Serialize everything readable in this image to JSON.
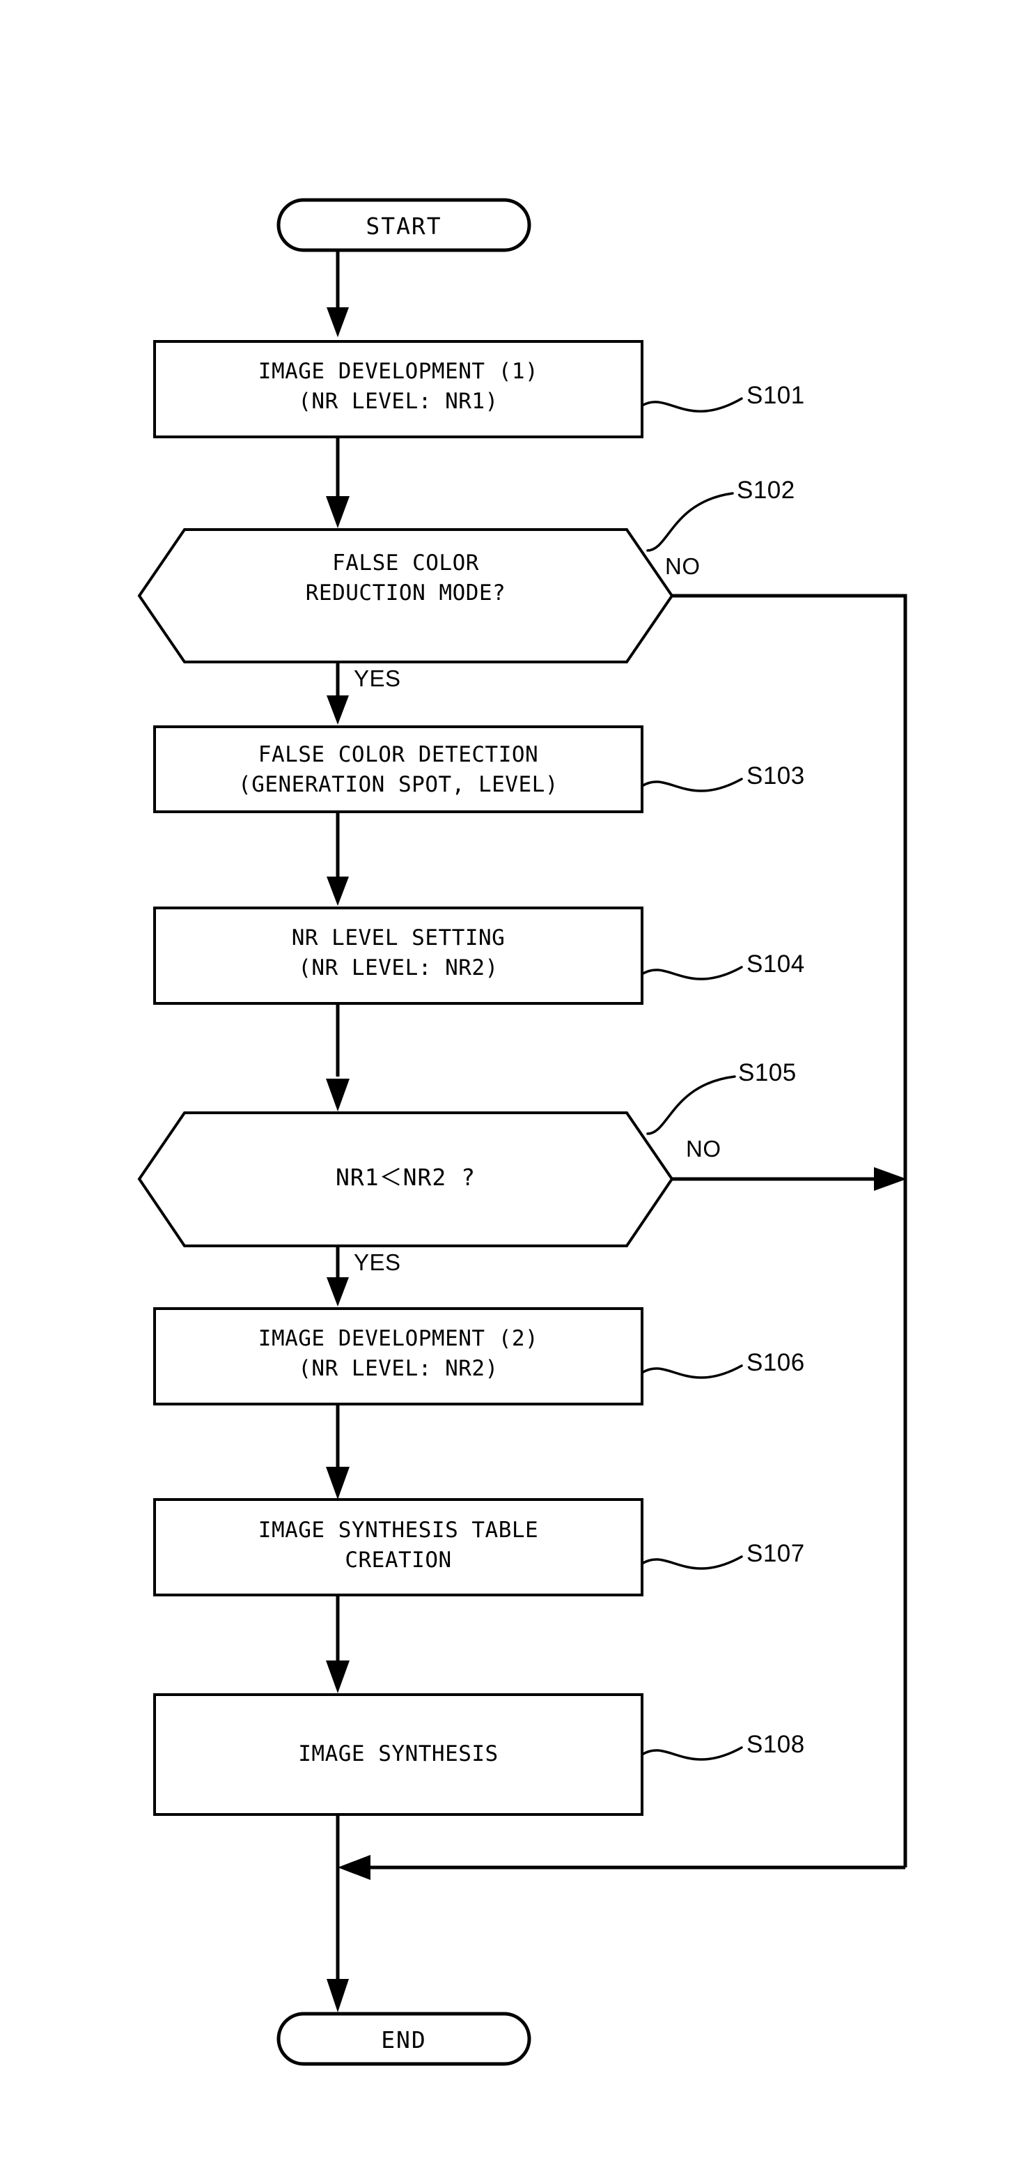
{
  "diagram": {
    "type": "flowchart",
    "title": "",
    "orientation": "top-to-bottom",
    "line_color": "#000000",
    "background_color": "#ffffff"
  },
  "nodes": [
    {
      "id": "start",
      "shape": "terminator",
      "text": "START",
      "step_label": ""
    },
    {
      "id": "s101",
      "shape": "process",
      "line1": "IMAGE DEVELOPMENT (1)",
      "line2": "(NR LEVEL: NR1)",
      "step_label": "S101"
    },
    {
      "id": "s102",
      "shape": "decision",
      "line1": "FALSE COLOR",
      "line2": "REDUCTION MODE?",
      "step_label": "S102",
      "yes_label": "YES",
      "no_label": "NO"
    },
    {
      "id": "s103",
      "shape": "process",
      "line1": "FALSE COLOR DETECTION",
      "line2": "(GENERATION SPOT, LEVEL)",
      "step_label": "S103"
    },
    {
      "id": "s104",
      "shape": "process",
      "line1": "NR LEVEL SETTING",
      "line2": "(NR LEVEL: NR2)",
      "step_label": "S104"
    },
    {
      "id": "s105",
      "shape": "decision",
      "line1": "NR1＜NR2 ?",
      "line2": "",
      "step_label": "S105",
      "yes_label": "YES",
      "no_label": "NO"
    },
    {
      "id": "s106",
      "shape": "process",
      "line1": "IMAGE DEVELOPMENT (2)",
      "line2": "(NR LEVEL: NR2)",
      "step_label": "S106"
    },
    {
      "id": "s107",
      "shape": "process",
      "line1": "IMAGE SYNTHESIS TABLE",
      "line2": "CREATION",
      "step_label": "S107"
    },
    {
      "id": "s108",
      "shape": "process",
      "line1": "IMAGE SYNTHESIS",
      "line2": "",
      "step_label": "S108"
    },
    {
      "id": "end",
      "shape": "terminator",
      "text": "END",
      "step_label": ""
    }
  ],
  "edges": [
    {
      "from": "start",
      "to": "s101",
      "label": ""
    },
    {
      "from": "s101",
      "to": "s102",
      "label": ""
    },
    {
      "from": "s102",
      "to": "s103",
      "label": "YES"
    },
    {
      "from": "s102",
      "to": "end",
      "label": "NO"
    },
    {
      "from": "s103",
      "to": "s104",
      "label": ""
    },
    {
      "from": "s104",
      "to": "s105",
      "label": ""
    },
    {
      "from": "s105",
      "to": "s106",
      "label": "YES"
    },
    {
      "from": "s105",
      "to": "end",
      "label": "NO"
    },
    {
      "from": "s106",
      "to": "s107",
      "label": ""
    },
    {
      "from": "s107",
      "to": "s108",
      "label": ""
    },
    {
      "from": "s108",
      "to": "end",
      "label": ""
    }
  ]
}
